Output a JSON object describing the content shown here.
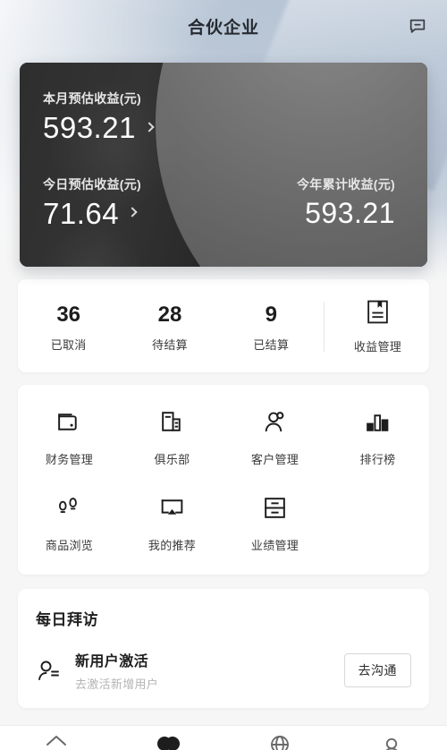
{
  "header": {
    "title": "合伙企业",
    "action_icon": "message-bubble-icon"
  },
  "hero": {
    "month": {
      "label": "本月预估收益(元)",
      "value": "593.21",
      "chevron": "chevron-right-icon"
    },
    "today": {
      "label": "今日预估收益(元)",
      "value": "71.64",
      "chevron": "chevron-right-icon"
    },
    "year": {
      "label": "今年累计收益(元)",
      "value": "593.21"
    }
  },
  "stats": {
    "items": [
      {
        "value": "36",
        "label": "已取消"
      },
      {
        "value": "28",
        "label": "待结算"
      },
      {
        "value": "9",
        "label": "已结算"
      }
    ],
    "action": {
      "label": "收益管理",
      "icon": "book-bookmark-icon"
    }
  },
  "menu": {
    "row1": [
      {
        "label": "财务管理",
        "icon": "wallet-icon"
      },
      {
        "label": "俱乐部",
        "icon": "building-icon"
      },
      {
        "label": "客户管理",
        "icon": "user-icon"
      },
      {
        "label": "排行榜",
        "icon": "bar-chart-icon"
      }
    ],
    "row2": [
      {
        "label": "商品浏览",
        "icon": "footprints-icon"
      },
      {
        "label": "我的推荐",
        "icon": "airplay-icon"
      },
      {
        "label": "业绩管理",
        "icon": "drawer-icon"
      }
    ]
  },
  "daily": {
    "title": "每日拜访",
    "items": [
      {
        "icon": "user-list-icon",
        "name": "新用户激活",
        "sub": "去激活新增用户",
        "button": "去沟通"
      }
    ]
  },
  "tabbar": {
    "items": [
      {
        "icon": "home-icon",
        "active": false
      },
      {
        "icon": "partners-icon",
        "active": true
      },
      {
        "icon": "globe-icon",
        "active": false
      },
      {
        "icon": "profile-icon",
        "active": false
      }
    ]
  },
  "colors": {
    "hero_dark": "#1b1b1b",
    "hero_light": "#7a7a7a",
    "page_bg": "#f6f6f6",
    "card_bg": "#ffffff",
    "text_primary": "#1d1d1d",
    "text_muted": "#b4b4b4",
    "backdrop_top": "#b6c4d4"
  }
}
